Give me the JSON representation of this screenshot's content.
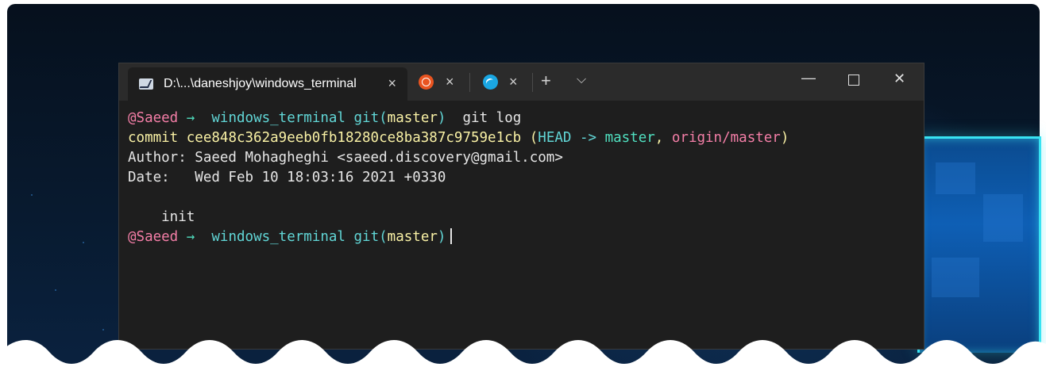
{
  "tabs": [
    {
      "title": "D:\\...\\daneshjoy\\windows_terminal",
      "icon": "powershell-icon",
      "close": "×"
    },
    {
      "title": "",
      "icon": "ubuntu-icon",
      "close": "×"
    },
    {
      "title": "",
      "icon": "azure-cloud-shell-icon",
      "close": "×"
    }
  ],
  "tabbar": {
    "new_tab": "+",
    "dropdown": "⌵"
  },
  "window_controls": {
    "minimize": "—",
    "close": "✕"
  },
  "terminal": {
    "line1": {
      "user": "@Saeed",
      "arrow": "→",
      "dir": "windows_terminal",
      "git": "git(",
      "branch": "master",
      "git_close": ")",
      "command": "git log"
    },
    "line2": {
      "label": "commit ",
      "hash": "cee848c362a9eeb0fb18280ce8ba387c9759e1cb",
      "open": " (",
      "head": "HEAD -> ",
      "master": "master",
      "comma": ", ",
      "origin": "origin/master",
      "close": ")"
    },
    "line3": "Author: Saeed Mohagheghi <saeed.discovery@gmail.com>",
    "line4": "Date:   Wed Feb 10 18:03:16 2021 +0330",
    "line5": "",
    "line6": "    init",
    "line7": {
      "user": "@Saeed",
      "arrow": "→",
      "dir": "windows_terminal",
      "git": "git(",
      "branch": "master",
      "git_close": ")"
    }
  },
  "colors": {
    "prompt_user": "#f47ea7",
    "prompt_dir": "#61d6d6",
    "branch": "#f9f1a5",
    "accent_glow": "#38e3f2"
  }
}
